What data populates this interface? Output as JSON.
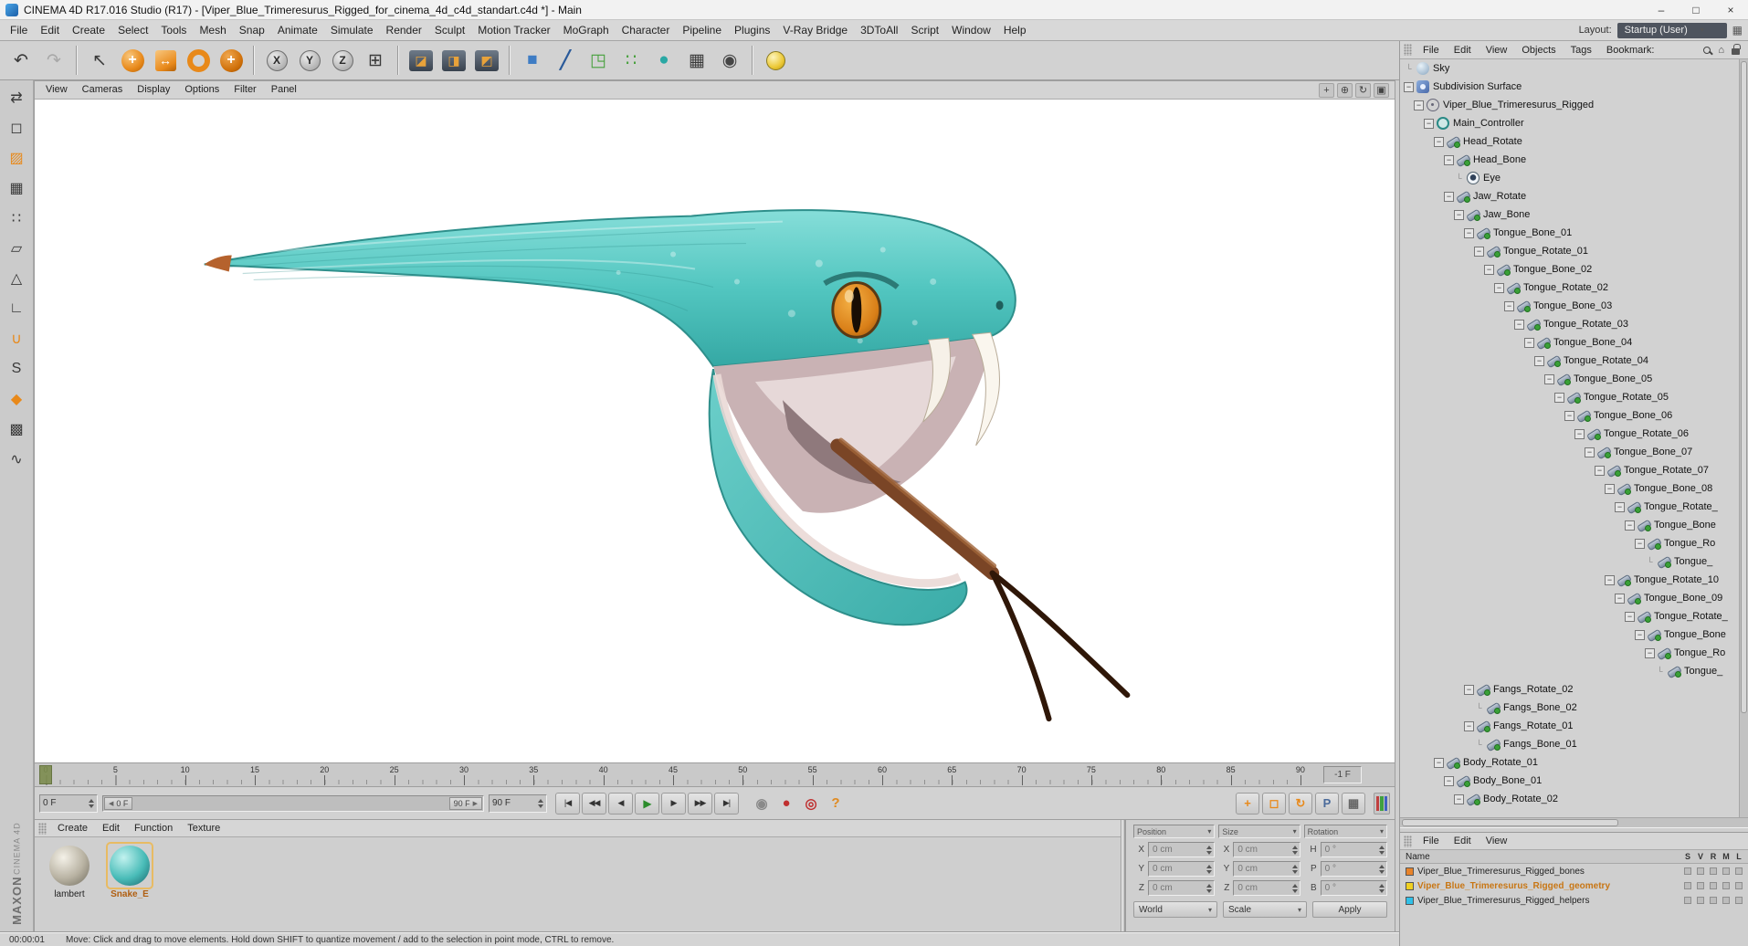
{
  "window": {
    "title": "CINEMA 4D R17.016 Studio (R17) - [Viper_Blue_Trimeresurus_Rigged_for_cinema_4d_c4d_standart.c4d *] - Main",
    "controls": {
      "minimize": "–",
      "maximize": "□",
      "close": "×"
    }
  },
  "menubar": {
    "items": [
      "File",
      "Edit",
      "Create",
      "Select",
      "Tools",
      "Mesh",
      "Snap",
      "Animate",
      "Simulate",
      "Render",
      "Sculpt",
      "Motion Tracker",
      "MoGraph",
      "Character",
      "Pipeline",
      "Plugins",
      "V-Ray Bridge",
      "3DToAll",
      "Script",
      "Window",
      "Help"
    ],
    "layout_label": "Layout:",
    "layout_value": "Startup (User)"
  },
  "toolbar": {
    "buttons": [
      {
        "name": "undo-button",
        "glyph": "↶",
        "kind": "plain"
      },
      {
        "name": "redo-button",
        "glyph": "↷",
        "kind": "dim"
      },
      {
        "sep": true
      },
      {
        "name": "live-selection-button",
        "glyph": "↖",
        "kind": "plain"
      },
      {
        "name": "move-tool-button",
        "glyph": "+",
        "kind": "orb"
      },
      {
        "name": "scale-tool-button",
        "glyph": "↔",
        "kind": "osq"
      },
      {
        "name": "rotate-tool-button",
        "glyph": "↻",
        "kind": "oring"
      },
      {
        "name": "last-tool-button",
        "glyph": "+",
        "kind": "orb2"
      },
      {
        "sep": true
      },
      {
        "name": "lock-x-axis-button",
        "glyph": "X",
        "kind": "axis"
      },
      {
        "name": "lock-y-axis-button",
        "glyph": "Y",
        "kind": "axis"
      },
      {
        "name": "lock-z-axis-button",
        "glyph": "Z",
        "kind": "axis"
      },
      {
        "name": "coordinate-system-button",
        "glyph": "⊞",
        "kind": "plain"
      },
      {
        "sep": true
      },
      {
        "name": "render-view-button",
        "glyph": "◪",
        "kind": "render"
      },
      {
        "name": "render-picture-viewer-button",
        "glyph": "◨",
        "kind": "render"
      },
      {
        "name": "render-settings-button",
        "glyph": "◩",
        "kind": "render"
      },
      {
        "sep": true
      },
      {
        "name": "add-cube-button",
        "glyph": "■",
        "kind": "blue"
      },
      {
        "name": "draw-spline-button",
        "glyph": "╱",
        "kind": "pen"
      },
      {
        "name": "subdivision-surface-button",
        "glyph": "◳",
        "kind": "green"
      },
      {
        "name": "cloner-button",
        "glyph": "∷",
        "kind": "green"
      },
      {
        "name": "sky-object-button",
        "glyph": "●",
        "kind": "teal"
      },
      {
        "name": "array-button",
        "glyph": "▦",
        "kind": "plain"
      },
      {
        "name": "camera-button",
        "glyph": "◉",
        "kind": "dark"
      },
      {
        "sep": true
      },
      {
        "name": "light-button",
        "glyph": "●",
        "kind": "yellow"
      }
    ]
  },
  "left_toolbar": {
    "buttons": [
      {
        "name": "make-editable-button",
        "glyph": "⇄",
        "kind": "plain"
      },
      {
        "name": "model-mode-button",
        "glyph": "◻",
        "kind": "plain"
      },
      {
        "name": "texture-mode-button",
        "glyph": "▨",
        "kind": "orange"
      },
      {
        "name": "workplane-mode-button",
        "glyph": "▦",
        "kind": "plain"
      },
      {
        "name": "points-mode-button",
        "glyph": "∷",
        "kind": "plain"
      },
      {
        "name": "edges-mode-button",
        "glyph": "▱",
        "kind": "plain"
      },
      {
        "name": "polygons-mode-button",
        "glyph": "△",
        "kind": "plain"
      },
      {
        "name": "axis-mode-button",
        "glyph": "∟",
        "kind": "plain"
      },
      {
        "name": "snap-toggle-button",
        "glyph": "∪",
        "kind": "orange"
      },
      {
        "name": "snap-settings-button",
        "glyph": "S",
        "kind": "plain"
      },
      {
        "name": "paint-tool-button",
        "glyph": "◆",
        "kind": "orange"
      },
      {
        "name": "checker-tool-button",
        "glyph": "▩",
        "kind": "plain"
      },
      {
        "name": "spline-tool-button",
        "glyph": "∿",
        "kind": "plain"
      }
    ]
  },
  "viewport": {
    "menus": [
      "View",
      "Cameras",
      "Display",
      "Options",
      "Filter",
      "Panel"
    ],
    "nav_icons": [
      {
        "name": "viewport-pan-icon",
        "glyph": "+"
      },
      {
        "name": "viewport-zoom-icon",
        "glyph": "⊕"
      },
      {
        "name": "viewport-rotate-icon",
        "glyph": "↻"
      },
      {
        "name": "viewport-toggle-icon",
        "glyph": "▣"
      }
    ]
  },
  "scene": {
    "subject": "blue viper snake with open mouth, fangs and forked tongue",
    "body_color": "#52c6c0",
    "eye_color": "#d97f18",
    "tongue_color": "#7a4526",
    "background": "#ffffff"
  },
  "timeline": {
    "ticks": [
      "0",
      "5",
      "10",
      "15",
      "20",
      "25",
      "30",
      "35",
      "40",
      "45",
      "50",
      "55",
      "60",
      "65",
      "70",
      "75",
      "80",
      "85",
      "90"
    ],
    "offset_label": "-1 F",
    "current_frame": "0 F",
    "range_start": "0 F",
    "range_end": "90 F",
    "end_frame": "90 F"
  },
  "transport": {
    "buttons": [
      {
        "name": "goto-start-button",
        "glyph": "|◀"
      },
      {
        "name": "previous-key-button",
        "glyph": "◀◀"
      },
      {
        "name": "previous-frame-button",
        "glyph": "◀"
      },
      {
        "name": "play-button",
        "glyph": "▶",
        "accent": true
      },
      {
        "name": "next-frame-button",
        "glyph": "▶"
      },
      {
        "name": "next-key-button",
        "glyph": "▶▶"
      },
      {
        "name": "goto-end-button",
        "glyph": "▶|"
      }
    ],
    "record_buttons": [
      {
        "name": "play-sound-button",
        "glyph": "◉",
        "color": "#8a8a8a"
      },
      {
        "name": "record-button",
        "glyph": "●",
        "color": "#c03030"
      },
      {
        "name": "autokey-button",
        "glyph": "◎",
        "color": "#c03030"
      },
      {
        "name": "help-button",
        "glyph": "?",
        "color": "#e08a20"
      }
    ],
    "record_toggles": [
      {
        "name": "record-position-toggle",
        "glyph": "+",
        "color": "#e8891a"
      },
      {
        "name": "record-scale-toggle",
        "glyph": "◻",
        "color": "#e8891a"
      },
      {
        "name": "record-rotation-toggle",
        "glyph": "↻",
        "color": "#e8891a"
      },
      {
        "name": "record-parameter-toggle",
        "glyph": "P",
        "color": "#4a6a9a"
      },
      {
        "name": "record-pla-toggle",
        "glyph": "▦",
        "color": "#666666"
      }
    ]
  },
  "materials": {
    "menu": [
      "Create",
      "Edit",
      "Function",
      "Texture"
    ],
    "items": [
      {
        "name": "lambert",
        "type": "gray",
        "selected": false
      },
      {
        "name": "Snake_E",
        "type": "teal",
        "selected": true
      }
    ]
  },
  "coordinates": {
    "headers": [
      "Position",
      "Size",
      "Rotation"
    ],
    "rows": [
      {
        "l1": "X",
        "v1": "0 cm",
        "l2": "X",
        "v2": "0 cm",
        "l3": "H",
        "v3": "0 °"
      },
      {
        "l1": "Y",
        "v1": "0 cm",
        "l2": "Y",
        "v2": "0 cm",
        "l3": "P",
        "v3": "0 °"
      },
      {
        "l1": "Z",
        "v1": "0 cm",
        "l2": "Z",
        "v2": "0 cm",
        "l3": "B",
        "v3": "0 °"
      }
    ],
    "system": "World",
    "mode": "Scale",
    "apply": "Apply"
  },
  "object_manager": {
    "menu": [
      "File",
      "Edit",
      "View",
      "Objects",
      "Tags",
      "Bookmark:"
    ],
    "tree": [
      {
        "label": "Sky",
        "depth": 0,
        "children": false,
        "type": "sky"
      },
      {
        "label": "Subdivision Surface",
        "depth": 0,
        "children": true,
        "type": "subdiv"
      },
      {
        "label": "Viper_Blue_Trimeresurus_Rigged",
        "depth": 1,
        "children": true,
        "type": "null"
      },
      {
        "label": "Main_Controller",
        "depth": 2,
        "children": true,
        "type": "controller"
      },
      {
        "label": "Head_Rotate",
        "depth": 3,
        "children": true,
        "type": "joint"
      },
      {
        "label": "Head_Bone",
        "depth": 4,
        "children": true,
        "type": "joint"
      },
      {
        "label": "Eye",
        "depth": 5,
        "children": false,
        "type": "eye"
      },
      {
        "label": "Jaw_Rotate",
        "depth": 4,
        "children": true,
        "type": "joint"
      },
      {
        "label": "Jaw_Bone",
        "depth": 5,
        "children": true,
        "type": "joint"
      },
      {
        "label": "Tongue_Bone_01",
        "depth": 6,
        "children": true,
        "type": "joint"
      },
      {
        "label": "Tongue_Rotate_01",
        "depth": 7,
        "children": true,
        "type": "joint"
      },
      {
        "label": "Tongue_Bone_02",
        "depth": 8,
        "children": true,
        "type": "joint"
      },
      {
        "label": "Tongue_Rotate_02",
        "depth": 9,
        "children": true,
        "type": "joint"
      },
      {
        "label": "Tongue_Bone_03",
        "depth": 10,
        "children": true,
        "type": "joint"
      },
      {
        "label": "Tongue_Rotate_03",
        "depth": 11,
        "children": true,
        "type": "joint"
      },
      {
        "label": "Tongue_Bone_04",
        "depth": 12,
        "children": true,
        "type": "joint"
      },
      {
        "label": "Tongue_Rotate_04",
        "depth": 13,
        "children": true,
        "type": "joint"
      },
      {
        "label": "Tongue_Bone_05",
        "depth": 14,
        "children": true,
        "type": "joint"
      },
      {
        "label": "Tongue_Rotate_05",
        "depth": 15,
        "children": true,
        "type": "joint"
      },
      {
        "label": "Tongue_Bone_06",
        "depth": 16,
        "children": true,
        "type": "joint"
      },
      {
        "label": "Tongue_Rotate_06",
        "depth": 17,
        "children": true,
        "type": "joint"
      },
      {
        "label": "Tongue_Bone_07",
        "depth": 18,
        "children": true,
        "type": "joint"
      },
      {
        "label": "Tongue_Rotate_07",
        "depth": 19,
        "children": true,
        "type": "joint"
      },
      {
        "label": "Tongue_Bone_08",
        "depth": 20,
        "children": true,
        "type": "joint"
      },
      {
        "label": "Tongue_Rotate_",
        "depth": 21,
        "children": true,
        "type": "joint"
      },
      {
        "label": "Tongue_Bone",
        "depth": 22,
        "children": true,
        "type": "joint"
      },
      {
        "label": "Tongue_Ro",
        "depth": 23,
        "children": true,
        "type": "joint"
      },
      {
        "label": "Tongue_",
        "depth": 24,
        "children": false,
        "type": "joint"
      },
      {
        "label": "Tongue_Rotate_10",
        "depth": 20,
        "children": true,
        "type": "joint"
      },
      {
        "label": "Tongue_Bone_09",
        "depth": 21,
        "children": true,
        "type": "joint"
      },
      {
        "label": "Tongue_Rotate_",
        "depth": 22,
        "children": true,
        "type": "joint"
      },
      {
        "label": "Tongue_Bone",
        "depth": 23,
        "children": true,
        "type": "joint"
      },
      {
        "label": "Tongue_Ro",
        "depth": 24,
        "children": true,
        "type": "joint"
      },
      {
        "label": "Tongue_",
        "depth": 25,
        "children": false,
        "type": "joint"
      },
      {
        "label": "Fangs_Rotate_02",
        "depth": 6,
        "children": true,
        "type": "joint"
      },
      {
        "label": "Fangs_Bone_02",
        "depth": 7,
        "children": false,
        "type": "joint"
      },
      {
        "label": "Fangs_Rotate_01",
        "depth": 6,
        "children": true,
        "type": "joint"
      },
      {
        "label": "Fangs_Bone_01",
        "depth": 7,
        "children": false,
        "type": "joint"
      },
      {
        "label": "Body_Rotate_01",
        "depth": 3,
        "children": true,
        "type": "joint"
      },
      {
        "label": "Body_Bone_01",
        "depth": 4,
        "children": true,
        "type": "joint"
      },
      {
        "label": "Body_Rotate_02",
        "depth": 5,
        "children": true,
        "type": "joint"
      }
    ]
  },
  "layers": {
    "menu": [
      "File",
      "Edit",
      "View"
    ],
    "name_header": "Name",
    "columns": [
      "S",
      "V",
      "R",
      "M",
      "L"
    ],
    "rows": [
      {
        "name": "Viper_Blue_Trimeresurus_Rigged_bones",
        "color": "#e8832a",
        "selected": false
      },
      {
        "name": "Viper_Blue_Trimeresurus_Rigged_geometry",
        "color": "#f0d020",
        "selected": true
      },
      {
        "name": "Viper_Blue_Trimeresurus_Rigged_helpers",
        "color": "#30c0e8",
        "selected": false
      }
    ]
  },
  "status": {
    "time": "00:00:01",
    "message": "Move: Click and drag to move elements. Hold down SHIFT to quantize movement / add to the selection in point mode, CTRL to remove."
  },
  "branding": {
    "line1": "MAXON",
    "line2": "CINEMA 4D"
  }
}
